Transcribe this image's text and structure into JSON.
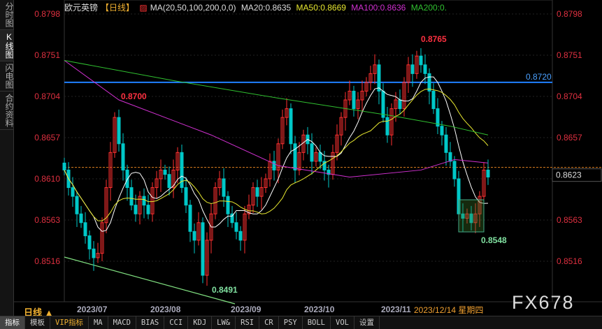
{
  "left_tabs": [
    "分时图",
    "K线图",
    "闪电图",
    "合约资料"
  ],
  "header": {
    "symbol": "欧元英镑",
    "period": "【日线】",
    "ma_label": "MA(20,50,100,200,0,0)",
    "ma20": "MA20:0.8635",
    "ma50": "MA50:0.8669",
    "ma100": "MA100:0.8636",
    "ma200": "MA200:0."
  },
  "colors": {
    "up": "#ff3030",
    "down": "#00c8c8",
    "ma20": "#ffffff",
    "ma50": "#e8e830",
    "ma100": "#d030d0",
    "ma200": "#30c030",
    "hline": "#2080ff",
    "price_red": "#ff3040",
    "annot_green": "#80e0a0"
  },
  "price_axis": [
    "0.8798",
    "0.8751",
    "0.8704",
    "0.8657",
    "0.8610",
    "0.8563",
    "0.8516"
  ],
  "current_price": "0.8623",
  "hline_label": "0.8720",
  "annotations": {
    "high": "0.8765",
    "peak_jul": "0.8700",
    "low_aug": "0.8491",
    "low_dec": "0.8548"
  },
  "x_labels": [
    "2023/07",
    "2023/08",
    "2023/09",
    "2023/10",
    "2023/11"
  ],
  "selected_date": "2023/12/14 星期四",
  "period_label": "日线 ▲",
  "logo": "FX678",
  "bottom_tabs": [
    "指标",
    "模板",
    "VIP指标",
    "MA",
    "MACD",
    "BIAS",
    "CCI",
    "KDJ",
    "LW&",
    "RSI",
    "CR",
    "PSY",
    "BOLL",
    "VOL",
    "设置"
  ],
  "chart_data": {
    "type": "candlestick",
    "ylim": [
      0.847,
      0.882
    ],
    "hline": 0.872,
    "current": 0.8623,
    "closes": [
      0.862,
      0.86,
      0.859,
      0.857,
      0.856,
      0.8545,
      0.853,
      0.852,
      0.8525,
      0.856,
      0.86,
      0.864,
      0.868,
      0.865,
      0.862,
      0.86,
      0.858,
      0.857,
      0.859,
      0.858,
      0.857,
      0.86,
      0.861,
      0.862,
      0.8615,
      0.86,
      0.862,
      0.864,
      0.86,
      0.858,
      0.855,
      0.854,
      0.856,
      0.85,
      0.854,
      0.857,
      0.86,
      0.861,
      0.859,
      0.857,
      0.856,
      0.855,
      0.854,
      0.857,
      0.858,
      0.86,
      0.859,
      0.86,
      0.861,
      0.863,
      0.862,
      0.865,
      0.868,
      0.869,
      0.865,
      0.862,
      0.864,
      0.866,
      0.865,
      0.863,
      0.864,
      0.863,
      0.862,
      0.8615,
      0.864,
      0.866,
      0.868,
      0.87,
      0.871,
      0.869,
      0.87,
      0.871,
      0.872,
      0.873,
      0.874,
      0.871,
      0.868,
      0.866,
      0.869,
      0.87,
      0.869,
      0.872,
      0.874,
      0.873,
      0.875,
      0.874,
      0.873,
      0.871,
      0.869,
      0.867,
      0.866,
      0.864,
      0.863,
      0.861,
      0.857,
      0.8565,
      0.857,
      0.856,
      0.857,
      0.859,
      0.862,
      0.8612
    ],
    "ma100": [
      [
        0,
        0.8745
      ],
      [
        13,
        0.87
      ],
      [
        35,
        0.866
      ],
      [
        51,
        0.8625
      ],
      [
        68,
        0.8612
      ],
      [
        85,
        0.862
      ],
      [
        93,
        0.8632
      ],
      [
        101,
        0.8628
      ]
    ],
    "ma200": [
      [
        0,
        0.8745
      ],
      [
        26,
        0.8722
      ],
      [
        51,
        0.8702
      ],
      [
        78,
        0.8682
      ],
      [
        92,
        0.867
      ],
      [
        101,
        0.866
      ]
    ]
  }
}
